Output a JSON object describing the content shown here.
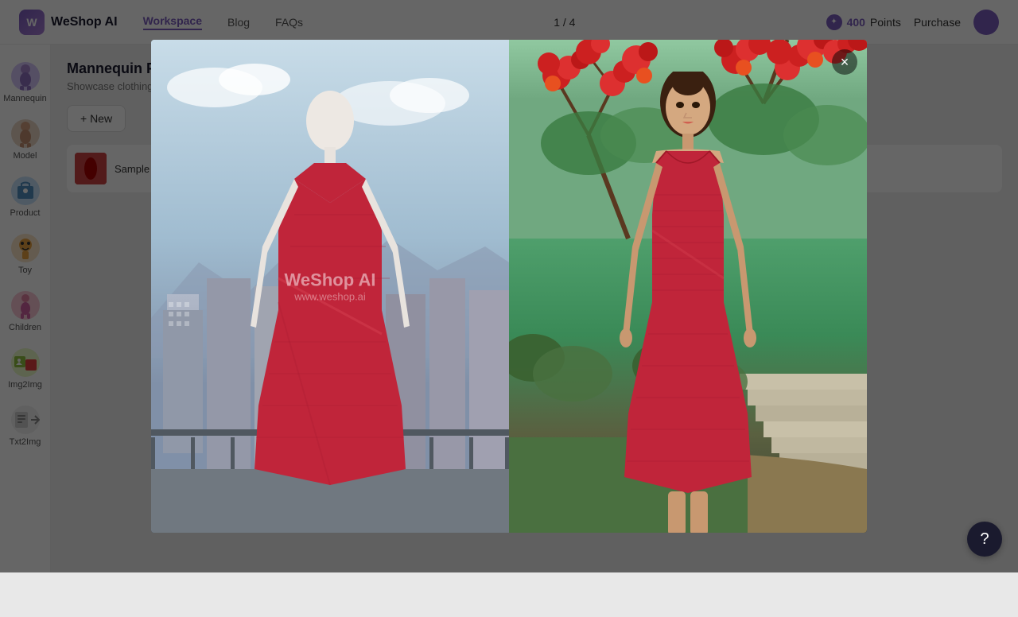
{
  "navbar": {
    "logo_text": "WeShop AI",
    "nav_links": [
      {
        "label": "Workspace",
        "active": true
      },
      {
        "label": "Blog",
        "active": false
      },
      {
        "label": "FAQs",
        "active": false
      }
    ],
    "pagination": "1 / 4",
    "points_value": "400",
    "points_label": "Points",
    "purchase_label": "Purchase"
  },
  "sidebar": {
    "items": [
      {
        "id": "mannequin",
        "label": "Mannequin"
      },
      {
        "id": "model",
        "label": "Model"
      },
      {
        "id": "product",
        "label": "Product"
      },
      {
        "id": "toy",
        "label": "Toy"
      },
      {
        "id": "children",
        "label": "Children"
      },
      {
        "id": "img2img",
        "label": "Img2Img"
      },
      {
        "id": "txt2img",
        "label": "Txt2Img"
      }
    ]
  },
  "main": {
    "title": "Mannequin Photo",
    "subtitle": "Showcase clothing with your brand's aesthetic",
    "new_task_label": "+ New",
    "sample_task_label": "Sample Task"
  },
  "lightbox": {
    "watermark_line1": "WeShop AI",
    "watermark_line2": "www.weshop.ai"
  },
  "help_btn": "?",
  "close_btn": "×",
  "nav_arrow_right": "›"
}
